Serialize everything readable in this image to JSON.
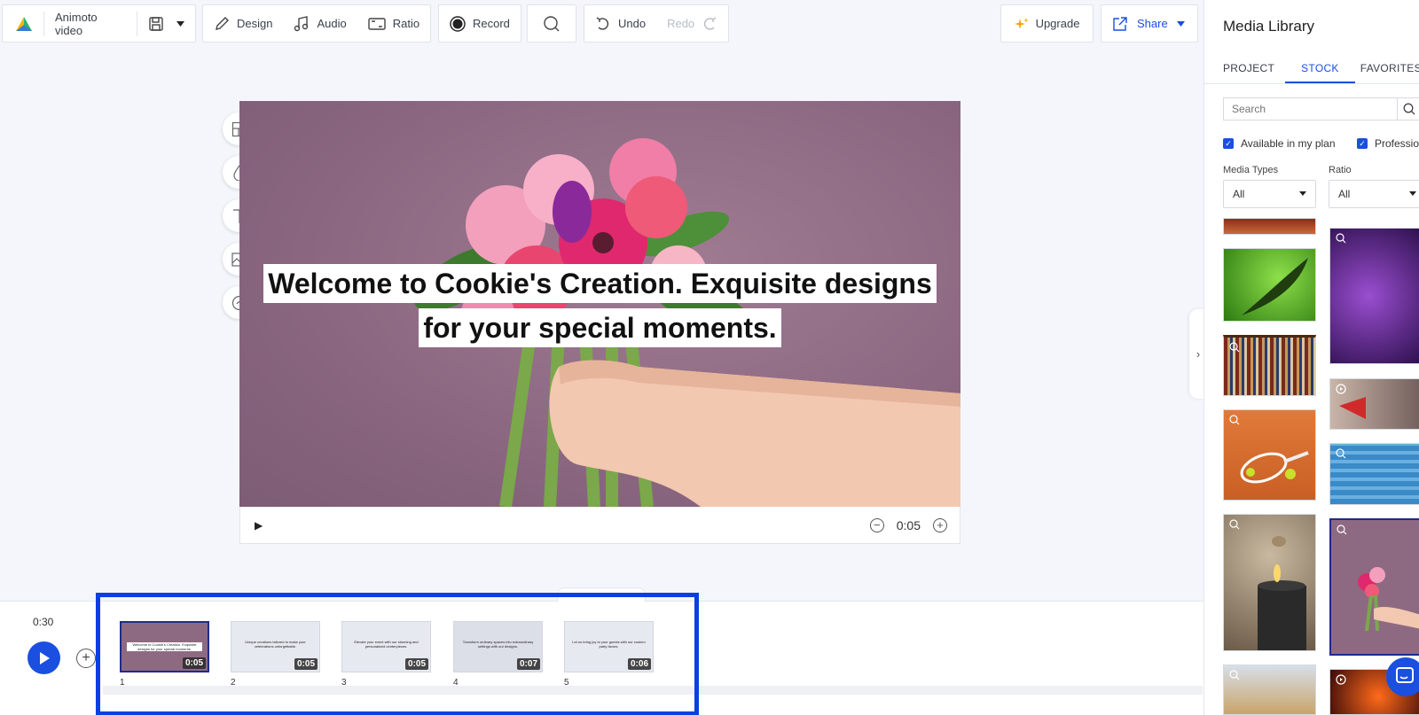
{
  "toolbar": {
    "project_name": "Animoto video",
    "design_label": "Design",
    "audio_label": "Audio",
    "ratio_label": "Ratio",
    "record_label": "Record",
    "undo_label": "Undo",
    "redo_label": "Redo",
    "upgrade_label": "Upgrade",
    "share_label": "Share"
  },
  "canvas": {
    "caption_line1": "Welcome to Cookie's Creation. Exquisite designs",
    "caption_line2": "for your special moments.",
    "duration": "0:05"
  },
  "timeline": {
    "total_time": "0:30",
    "scenes": [
      {
        "num": "1",
        "duration": "0:05",
        "text": "Welcome to Cookie's Creation. Exquisite designs for your special moments."
      },
      {
        "num": "2",
        "duration": "0:05",
        "text": "Unique creations tailored to make your celebrations unforgettable."
      },
      {
        "num": "3",
        "duration": "0:05",
        "text": "Elevate your event with our stunning and personalized centerpieces."
      },
      {
        "num": "4",
        "duration": "0:07",
        "text": "Transform ordinary spaces into extraordinary settings with our designs."
      },
      {
        "num": "5",
        "duration": "0:06",
        "text": "Let us bring joy to your guests with our custom party favors."
      }
    ]
  },
  "library": {
    "title": "Media Library",
    "tabs": [
      "PROJECT",
      "STOCK",
      "FAVORITES"
    ],
    "active_tab": "STOCK",
    "search_placeholder": "Search",
    "check_available": "Available in my plan",
    "check_professional": "Professional",
    "media_types_label": "Media Types",
    "media_types_value": "All",
    "ratio_label": "Ratio",
    "ratio_value": "All"
  },
  "colors": {
    "accent": "#1a4fe0",
    "highlight_box": "#0a3fe0",
    "stage_bg": "#8e6a82"
  }
}
